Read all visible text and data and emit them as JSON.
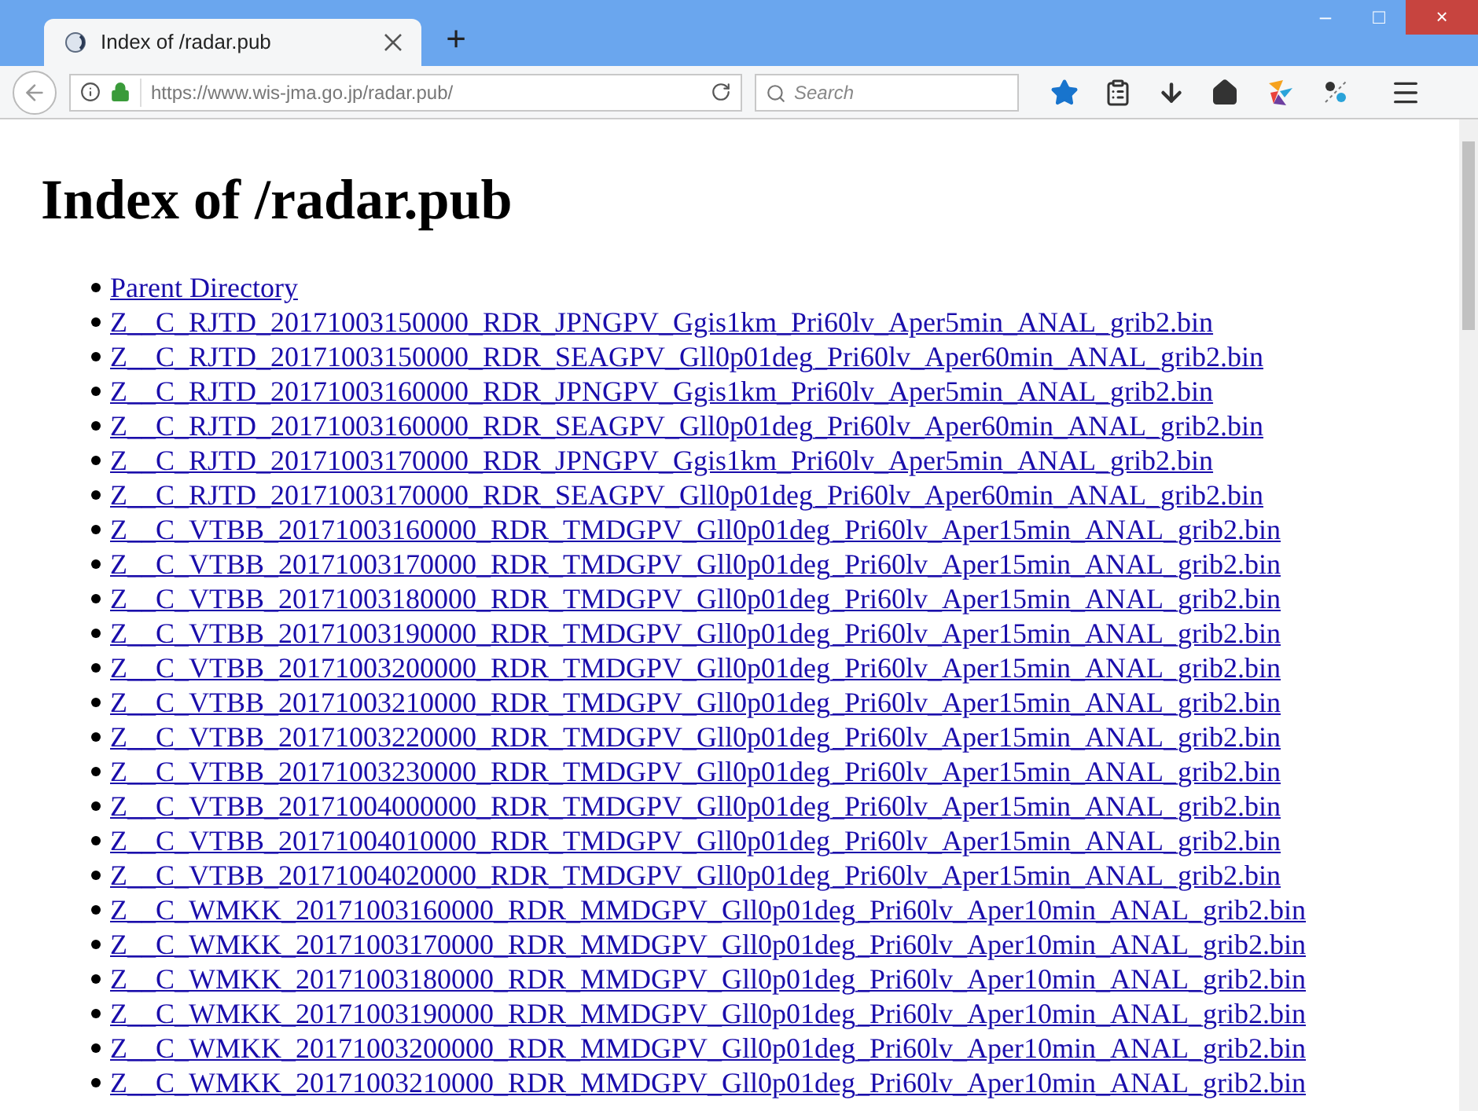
{
  "window": {
    "controls": [
      "–",
      "□",
      "×"
    ]
  },
  "tabs": [
    {
      "title": "Index of /radar.pub",
      "selected": true
    }
  ],
  "new_tab": "+",
  "address_bar": {
    "url_host": "https://www.wis-jma.go.jp",
    "url_path": "/radar.pub/"
  },
  "search": {
    "placeholder": "Search"
  },
  "page": {
    "heading": "Index of /radar.pub",
    "links": [
      "Parent Directory",
      "Z__C_RJTD_20171003150000_RDR_JPNGPV_Ggis1km_Pri60lv_Aper5min_ANAL_grib2.bin",
      "Z__C_RJTD_20171003150000_RDR_SEAGPV_Gll0p01deg_Pri60lv_Aper60min_ANAL_grib2.bin",
      "Z__C_RJTD_20171003160000_RDR_JPNGPV_Ggis1km_Pri60lv_Aper5min_ANAL_grib2.bin",
      "Z__C_RJTD_20171003160000_RDR_SEAGPV_Gll0p01deg_Pri60lv_Aper60min_ANAL_grib2.bin",
      "Z__C_RJTD_20171003170000_RDR_JPNGPV_Ggis1km_Pri60lv_Aper5min_ANAL_grib2.bin",
      "Z__C_RJTD_20171003170000_RDR_SEAGPV_Gll0p01deg_Pri60lv_Aper60min_ANAL_grib2.bin",
      "Z__C_VTBB_20171003160000_RDR_TMDGPV_Gll0p01deg_Pri60lv_Aper15min_ANAL_grib2.bin",
      "Z__C_VTBB_20171003170000_RDR_TMDGPV_Gll0p01deg_Pri60lv_Aper15min_ANAL_grib2.bin",
      "Z__C_VTBB_20171003180000_RDR_TMDGPV_Gll0p01deg_Pri60lv_Aper15min_ANAL_grib2.bin",
      "Z__C_VTBB_20171003190000_RDR_TMDGPV_Gll0p01deg_Pri60lv_Aper15min_ANAL_grib2.bin",
      "Z__C_VTBB_20171003200000_RDR_TMDGPV_Gll0p01deg_Pri60lv_Aper15min_ANAL_grib2.bin",
      "Z__C_VTBB_20171003210000_RDR_TMDGPV_Gll0p01deg_Pri60lv_Aper15min_ANAL_grib2.bin",
      "Z__C_VTBB_20171003220000_RDR_TMDGPV_Gll0p01deg_Pri60lv_Aper15min_ANAL_grib2.bin",
      "Z__C_VTBB_20171003230000_RDR_TMDGPV_Gll0p01deg_Pri60lv_Aper15min_ANAL_grib2.bin",
      "Z__C_VTBB_20171004000000_RDR_TMDGPV_Gll0p01deg_Pri60lv_Aper15min_ANAL_grib2.bin",
      "Z__C_VTBB_20171004010000_RDR_TMDGPV_Gll0p01deg_Pri60lv_Aper15min_ANAL_grib2.bin",
      "Z__C_VTBB_20171004020000_RDR_TMDGPV_Gll0p01deg_Pri60lv_Aper15min_ANAL_grib2.bin",
      "Z__C_WMKK_20171003160000_RDR_MMDGPV_Gll0p01deg_Pri60lv_Aper10min_ANAL_grib2.bin",
      "Z__C_WMKK_20171003170000_RDR_MMDGPV_Gll0p01deg_Pri60lv_Aper10min_ANAL_grib2.bin",
      "Z__C_WMKK_20171003180000_RDR_MMDGPV_Gll0p01deg_Pri60lv_Aper10min_ANAL_grib2.bin",
      "Z__C_WMKK_20171003190000_RDR_MMDGPV_Gll0p01deg_Pri60lv_Aper10min_ANAL_grib2.bin",
      "Z__C_WMKK_20171003200000_RDR_MMDGPV_Gll0p01deg_Pri60lv_Aper10min_ANAL_grib2.bin",
      "Z__C_WMKK_20171003210000_RDR_MMDGPV_Gll0p01deg_Pri60lv_Aper10min_ANAL_grib2.bin"
    ]
  }
}
